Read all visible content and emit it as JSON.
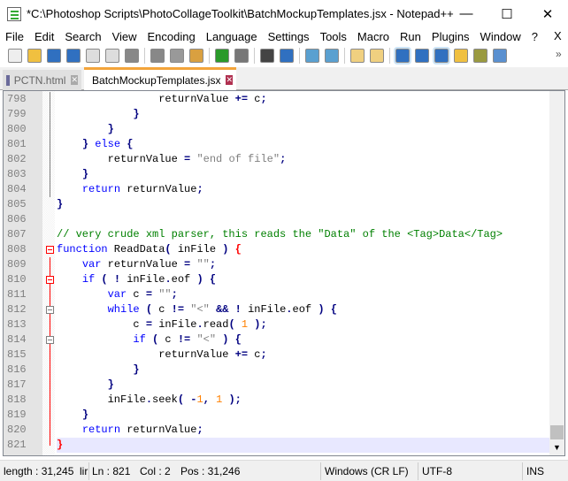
{
  "window": {
    "title": "*C:\\Photoshop Scripts\\PhotoCollageToolkit\\BatchMockupTemplates.jsx - Notepad++",
    "minimize": "—",
    "maximize": "☐",
    "close": "✕"
  },
  "menu": [
    "File",
    "Edit",
    "Search",
    "View",
    "Encoding",
    "Language",
    "Settings",
    "Tools",
    "Macro",
    "Run",
    "Plugins",
    "Window",
    "?"
  ],
  "menu_close": "X",
  "toolbar_more": "»",
  "toolbar": [
    "new-file",
    "open-file",
    "save",
    "save-all",
    "close",
    "close-all",
    "print",
    "cut",
    "copy",
    "paste",
    "undo",
    "redo",
    "find",
    "replace",
    "zoom-in",
    "zoom-out",
    "sync-vertical",
    "sync-horizontal",
    "word-wrap",
    "show-all-characters",
    "indent-guide",
    "user-defined-language",
    "document-map",
    "document-list"
  ],
  "tabs": [
    {
      "label": "PCTN.html",
      "active": false
    },
    {
      "label": "BatchMockupTemplates.jsx",
      "active": true
    }
  ],
  "editor": {
    "current_line": 821,
    "lines": [
      {
        "n": 798,
        "t": [
          [
            "ws",
            "                "
          ],
          [
            "id",
            "returnValue "
          ],
          [
            "op",
            "+="
          ],
          [
            "id",
            " c"
          ],
          [
            "op",
            ";"
          ]
        ]
      },
      {
        "n": 799,
        "t": [
          [
            "ws",
            "            "
          ],
          [
            "op",
            "}"
          ]
        ]
      },
      {
        "n": 800,
        "t": [
          [
            "ws",
            "        "
          ],
          [
            "op",
            "}"
          ]
        ]
      },
      {
        "n": 801,
        "t": [
          [
            "ws",
            "    "
          ],
          [
            "op",
            "}"
          ],
          [
            "id",
            " "
          ],
          [
            "kw",
            "else"
          ],
          [
            "id",
            " "
          ],
          [
            "op",
            "{"
          ]
        ]
      },
      {
        "n": 802,
        "t": [
          [
            "ws",
            "        "
          ],
          [
            "id",
            "returnValue "
          ],
          [
            "op",
            "="
          ],
          [
            "id",
            " "
          ],
          [
            "str",
            "\"end of file\""
          ],
          [
            "op",
            ";"
          ]
        ]
      },
      {
        "n": 803,
        "t": [
          [
            "ws",
            "    "
          ],
          [
            "op",
            "}"
          ]
        ]
      },
      {
        "n": 804,
        "t": [
          [
            "ws",
            "    "
          ],
          [
            "kw",
            "return"
          ],
          [
            "id",
            " returnValue"
          ],
          [
            "op",
            ";"
          ]
        ]
      },
      {
        "n": 805,
        "t": [
          [
            "op",
            "}"
          ]
        ]
      },
      {
        "n": 806,
        "t": []
      },
      {
        "n": 807,
        "t": [
          [
            "cmt",
            "// very crude xml parser, this reads the \"Data\" of the <Tag>Data</Tag>"
          ]
        ]
      },
      {
        "n": 808,
        "t": [
          [
            "kw",
            "function"
          ],
          [
            "id",
            " ReadData"
          ],
          [
            "op",
            "("
          ],
          [
            "id",
            " inFile "
          ],
          [
            "op",
            ")"
          ],
          [
            "id",
            " "
          ],
          [
            "br",
            "{"
          ]
        ]
      },
      {
        "n": 809,
        "t": [
          [
            "ws",
            "    "
          ],
          [
            "kw",
            "var"
          ],
          [
            "id",
            " returnValue "
          ],
          [
            "op",
            "="
          ],
          [
            "id",
            " "
          ],
          [
            "str",
            "\"\""
          ],
          [
            "op",
            ";"
          ]
        ]
      },
      {
        "n": 810,
        "t": [
          [
            "ws",
            "    "
          ],
          [
            "kw",
            "if"
          ],
          [
            "id",
            " "
          ],
          [
            "op",
            "("
          ],
          [
            "id",
            " "
          ],
          [
            "op",
            "!"
          ],
          [
            "id",
            " inFile"
          ],
          [
            "op",
            "."
          ],
          [
            "id",
            "eof "
          ],
          [
            "op",
            ")"
          ],
          [
            "id",
            " "
          ],
          [
            "op",
            "{"
          ]
        ]
      },
      {
        "n": 811,
        "t": [
          [
            "ws",
            "        "
          ],
          [
            "kw",
            "var"
          ],
          [
            "id",
            " c "
          ],
          [
            "op",
            "="
          ],
          [
            "id",
            " "
          ],
          [
            "str",
            "\"\""
          ],
          [
            "op",
            ";"
          ]
        ]
      },
      {
        "n": 812,
        "t": [
          [
            "ws",
            "        "
          ],
          [
            "kw",
            "while"
          ],
          [
            "id",
            " "
          ],
          [
            "op",
            "("
          ],
          [
            "id",
            " c "
          ],
          [
            "op",
            "!="
          ],
          [
            "id",
            " "
          ],
          [
            "str",
            "\"<\""
          ],
          [
            "id",
            " "
          ],
          [
            "op",
            "&&"
          ],
          [
            "id",
            " "
          ],
          [
            "op",
            "!"
          ],
          [
            "id",
            " inFile"
          ],
          [
            "op",
            "."
          ],
          [
            "id",
            "eof "
          ],
          [
            "op",
            ")"
          ],
          [
            "id",
            " "
          ],
          [
            "op",
            "{"
          ]
        ]
      },
      {
        "n": 813,
        "t": [
          [
            "ws",
            "            "
          ],
          [
            "id",
            "c "
          ],
          [
            "op",
            "="
          ],
          [
            "id",
            " inFile"
          ],
          [
            "op",
            "."
          ],
          [
            "id",
            "read"
          ],
          [
            "op",
            "("
          ],
          [
            "id",
            " "
          ],
          [
            "num2",
            "1"
          ],
          [
            "id",
            " "
          ],
          [
            "op",
            ")"
          ],
          [
            "op",
            ";"
          ]
        ]
      },
      {
        "n": 814,
        "t": [
          [
            "ws",
            "            "
          ],
          [
            "kw",
            "if"
          ],
          [
            "id",
            " "
          ],
          [
            "op",
            "("
          ],
          [
            "id",
            " c "
          ],
          [
            "op",
            "!="
          ],
          [
            "id",
            " "
          ],
          [
            "str",
            "\"<\""
          ],
          [
            "id",
            " "
          ],
          [
            "op",
            ")"
          ],
          [
            "id",
            " "
          ],
          [
            "op",
            "{"
          ]
        ]
      },
      {
        "n": 815,
        "t": [
          [
            "ws",
            "                "
          ],
          [
            "id",
            "returnValue "
          ],
          [
            "op",
            "+="
          ],
          [
            "id",
            " c"
          ],
          [
            "op",
            ";"
          ]
        ]
      },
      {
        "n": 816,
        "t": [
          [
            "ws",
            "            "
          ],
          [
            "op",
            "}"
          ]
        ]
      },
      {
        "n": 817,
        "t": [
          [
            "ws",
            "        "
          ],
          [
            "op",
            "}"
          ]
        ]
      },
      {
        "n": 818,
        "t": [
          [
            "ws",
            "        "
          ],
          [
            "id",
            "inFile"
          ],
          [
            "op",
            "."
          ],
          [
            "id",
            "seek"
          ],
          [
            "op",
            "("
          ],
          [
            "id",
            " "
          ],
          [
            "op",
            "-"
          ],
          [
            "num2",
            "1"
          ],
          [
            "op",
            ","
          ],
          [
            "id",
            " "
          ],
          [
            "num2",
            "1"
          ],
          [
            "id",
            " "
          ],
          [
            "op",
            ")"
          ],
          [
            "op",
            ";"
          ]
        ]
      },
      {
        "n": 819,
        "t": [
          [
            "ws",
            "    "
          ],
          [
            "op",
            "}"
          ]
        ]
      },
      {
        "n": 820,
        "t": [
          [
            "ws",
            "    "
          ],
          [
            "kw",
            "return"
          ],
          [
            "id",
            " returnValue"
          ],
          [
            "op",
            ";"
          ]
        ]
      },
      {
        "n": 821,
        "t": [
          [
            "br",
            "}"
          ]
        ]
      }
    ]
  },
  "status": {
    "length": "length : 31,245",
    "lines": "lir",
    "ln": "Ln : 821",
    "col": "Col : 2",
    "pos": "Pos : 31,246",
    "eol": "Windows (CR LF)",
    "encoding": "UTF-8",
    "mode": "INS"
  }
}
